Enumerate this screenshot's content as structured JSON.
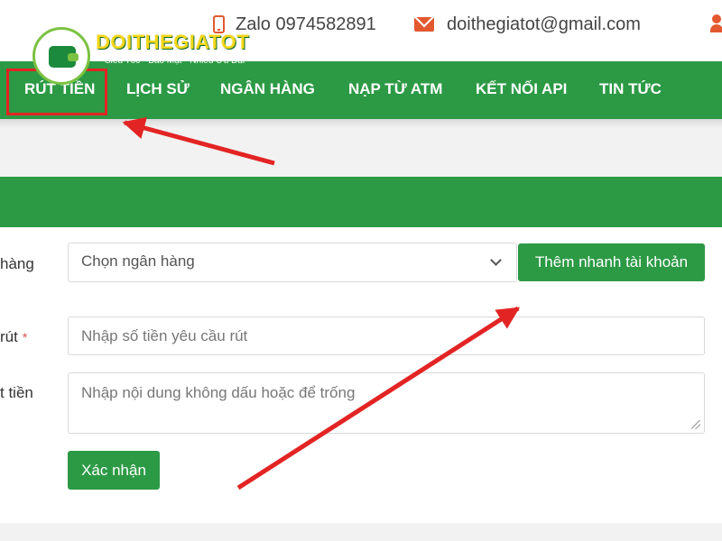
{
  "header": {
    "logo_name": "DOITHEGIATOT",
    "logo_slogan": "Siêu Tốc - Bảo Mật - Nhiều Ưu Đãi",
    "zalo": "Zalo 0974582891",
    "email": "doithegiatot@gmail.com"
  },
  "nav": {
    "items": [
      "RÚT TIỀN",
      "LỊCH SỬ",
      "NGÂN HÀNG",
      "NẠP TỪ ATM",
      "KẾT NỐI API",
      "TIN TỨC"
    ]
  },
  "form": {
    "bank_label": "hàng",
    "bank_selected": "Chọn ngân hàng",
    "add_account_button": "Thêm nhanh tài khoản",
    "amount_label": "rút",
    "amount_required_mark": "*",
    "amount_placeholder": "Nhập số tiền yêu cầu rút",
    "note_label": "t tiền",
    "note_placeholder": "Nhập nội dung không dấu hoặc để trống",
    "submit_button": "Xác nhận"
  },
  "colors": {
    "brand_green": "#2c9a45",
    "contact_orange": "#e3582f",
    "annotation_red": "#e32424"
  }
}
